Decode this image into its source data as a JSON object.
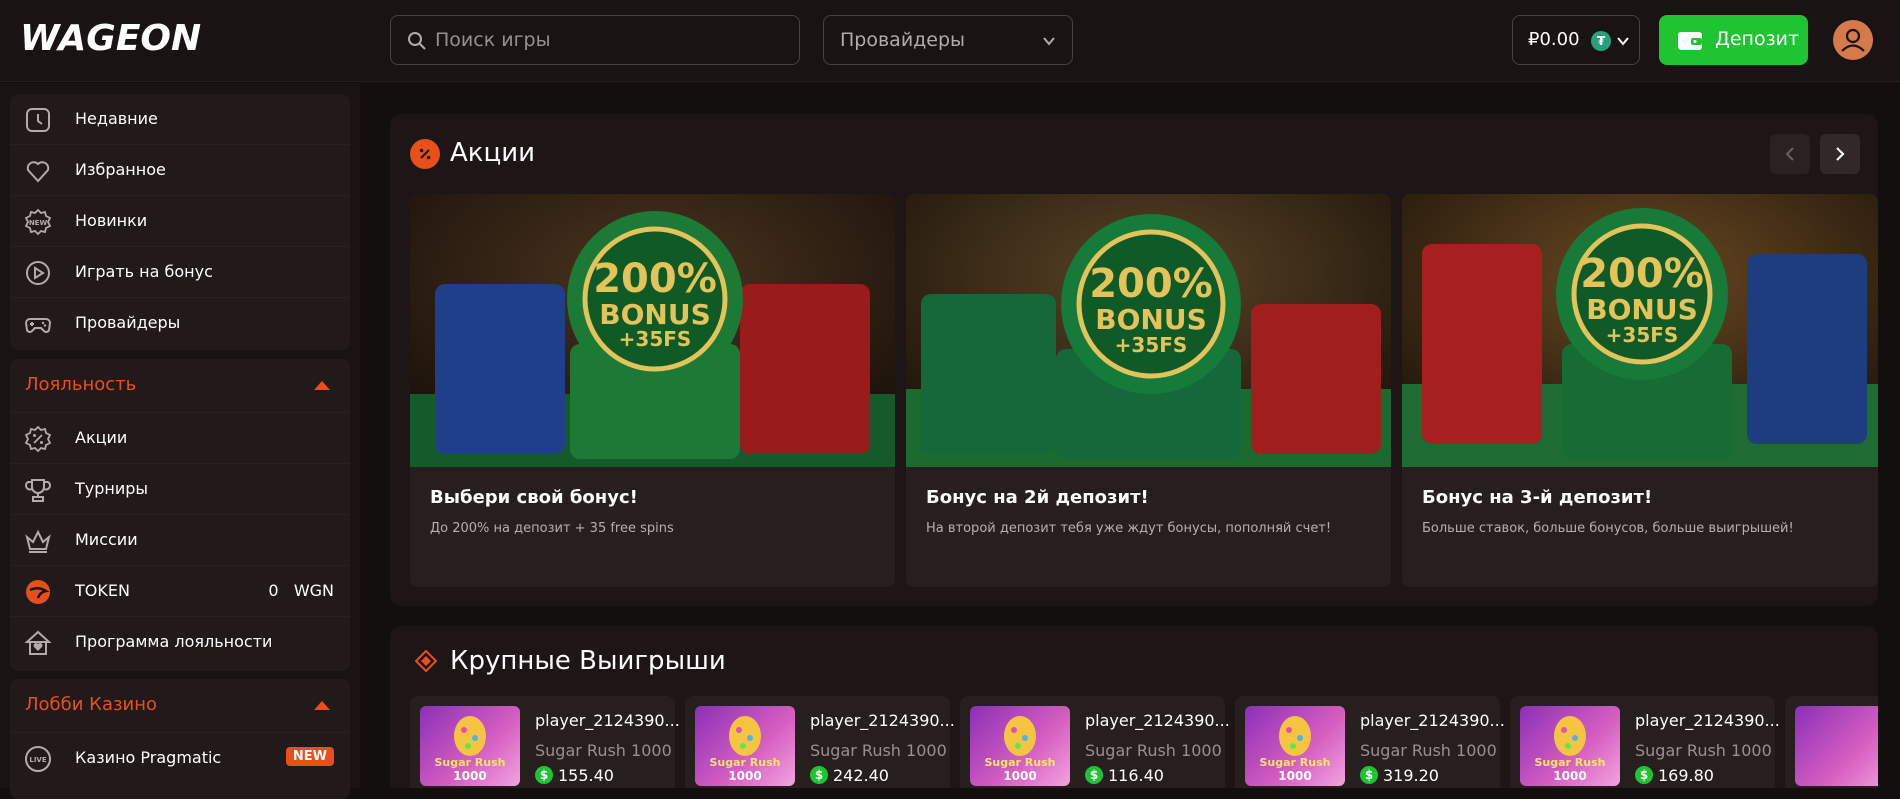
{
  "header": {
    "logo": "WAGEON",
    "search_placeholder": "Поиск игры",
    "providers_label": "Провайдеры",
    "balance": "₽0.00",
    "tether_symbol": "₮",
    "deposit_label": "Депозит"
  },
  "sidebar": {
    "main_items": [
      {
        "label": "Недавние",
        "icon": "clock-icon"
      },
      {
        "label": "Избранное",
        "icon": "heart-icon"
      },
      {
        "label": "Новинки",
        "icon": "new-badge-icon"
      },
      {
        "label": "Играть на бонус",
        "icon": "play-bonus-icon"
      },
      {
        "label": "Провайдеры",
        "icon": "gamepad-icon"
      }
    ],
    "loyalty": {
      "title": "Лояльность",
      "items": [
        {
          "label": "Акции",
          "icon": "percent-badge-icon"
        },
        {
          "label": "Турниры",
          "icon": "trophy-icon"
        },
        {
          "label": "Миссии",
          "icon": "crown-icon"
        },
        {
          "label": "TOKEN",
          "icon": "wageon-token-icon",
          "value": "0",
          "unit": "WGN"
        },
        {
          "label": "Программа лояльности",
          "icon": "loyalty-house-icon"
        }
      ]
    },
    "lobby": {
      "title": "Лобби Казино",
      "items": [
        {
          "label": "Казино Pragmatic",
          "icon": "live-icon",
          "badge": "NEW"
        }
      ]
    }
  },
  "promotions": {
    "title": "Акции",
    "cards": [
      {
        "title": "Выбери свой бонус!",
        "desc": "До 200% на депозит + 35 free spins",
        "chip_line1": "200%",
        "chip_line2": "BONUS",
        "chip_line3": "+35FS"
      },
      {
        "title": "Бонус на 2й депозит!",
        "desc": "На второй депозит тебя уже ждут бонусы, пополняй счет!",
        "chip_line1": "200%",
        "chip_line2": "BONUS",
        "chip_line3": "+35FS"
      },
      {
        "title": "Бонус на 3-й депозит!",
        "desc": "Больше ставок, больше бонусов, больше выигрышей!",
        "chip_line1": "200%",
        "chip_line2": "BONUS",
        "chip_line3": "+35FS"
      }
    ]
  },
  "big_wins": {
    "title": "Крупные Выигрыши",
    "items": [
      {
        "player": "player_2124390...",
        "game": "Sugar Rush 1000",
        "amount": "155.40",
        "thumb_line1": "Sugar Rush",
        "thumb_line2": "1000"
      },
      {
        "player": "player_2124390...",
        "game": "Sugar Rush 1000",
        "amount": "242.40",
        "thumb_line1": "Sugar Rush",
        "thumb_line2": "1000"
      },
      {
        "player": "player_2124390...",
        "game": "Sugar Rush 1000",
        "amount": "116.40",
        "thumb_line1": "Sugar Rush",
        "thumb_line2": "1000"
      },
      {
        "player": "player_2124390...",
        "game": "Sugar Rush 1000",
        "amount": "319.20",
        "thumb_line1": "Sugar Rush",
        "thumb_line2": "1000"
      },
      {
        "player": "player_2124390...",
        "game": "Sugar Rush 1000",
        "amount": "169.80",
        "thumb_line1": "Sugar Rush",
        "thumb_line2": "1000"
      }
    ],
    "currency_symbol": "$"
  },
  "colors": {
    "accent": "#e8501b",
    "deposit_green": "#1ec431",
    "background": "#140f0f",
    "panel": "#1e1616"
  }
}
